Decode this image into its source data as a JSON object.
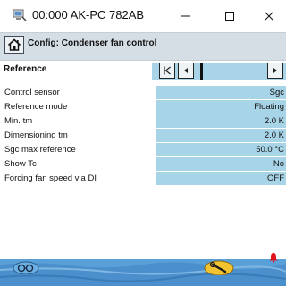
{
  "window": {
    "title": "00:000 AK-PC 782AB",
    "icons": {
      "app": "monitor-plug-icon",
      "minimize": "minimize-icon",
      "maximize": "maximize-icon",
      "close": "close-icon"
    }
  },
  "header": {
    "title": "Config: Condenser fan control",
    "home_icon": "home-icon"
  },
  "reference": {
    "label": "Reference",
    "nav_icons": [
      "first-page-icon",
      "previous-page-icon",
      "current-page-marker",
      "next-page-icon"
    ]
  },
  "params": [
    {
      "label": "Control sensor",
      "value": "Sgc"
    },
    {
      "label": "Reference mode",
      "value": "Floating"
    },
    {
      "label": "Min. tm",
      "value": "2.0 K"
    },
    {
      "label": "Dimensioning tm",
      "value": "2.0 K"
    },
    {
      "label": "Sgc max reference",
      "value": "50.0 °C"
    },
    {
      "label": "Show Tc",
      "value": "No"
    },
    {
      "label": "Forcing fan speed via DI",
      "value": "OFF"
    }
  ],
  "footer": {
    "left_icon": "glasses-icon",
    "center_icon": "wrench-icon",
    "alarm_icon": "alarm-bell-icon"
  },
  "colors": {
    "header_bg": "#d6dee5",
    "value_bg": "#a8d4e8",
    "footer_bg": "#5aa0d8",
    "alarm": "#e0101a"
  }
}
